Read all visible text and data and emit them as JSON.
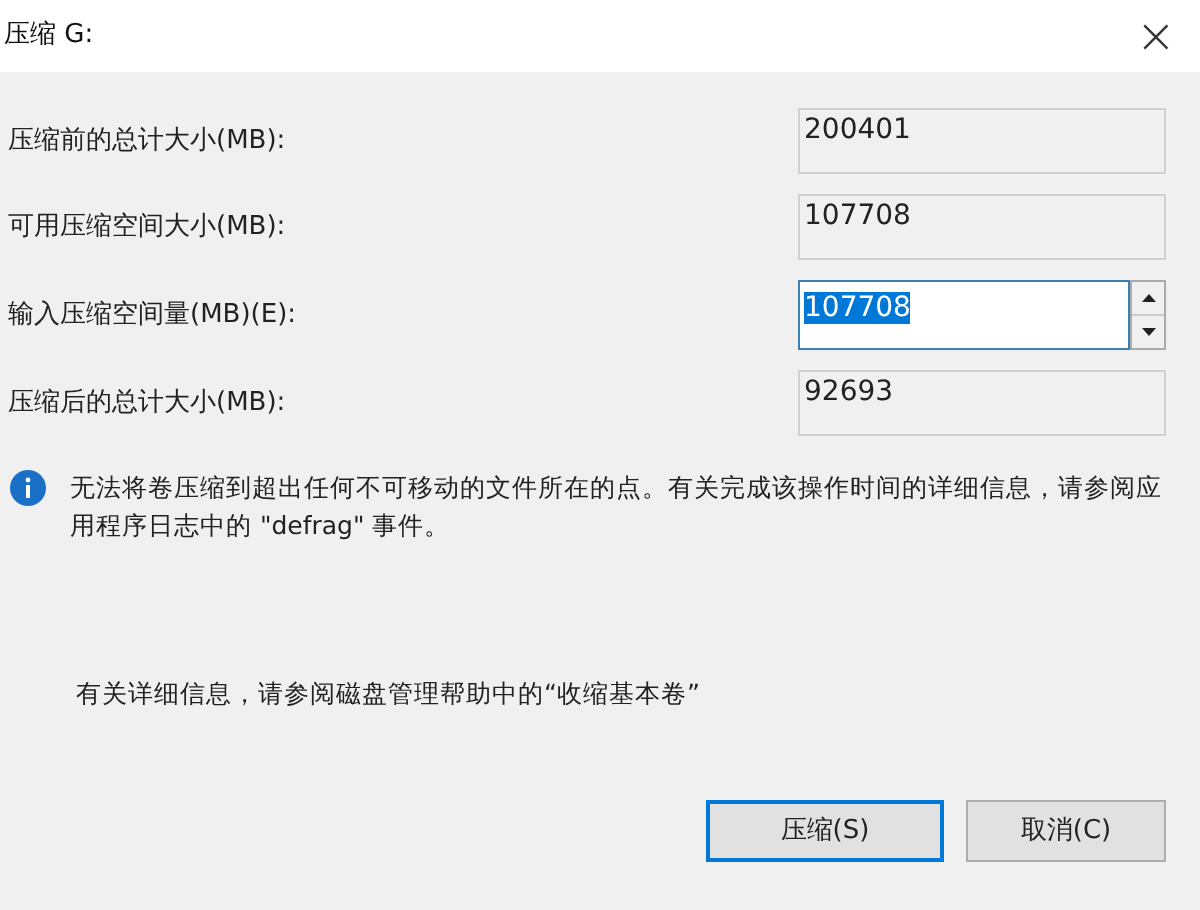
{
  "window": {
    "title": "压缩 G:",
    "close": "×"
  },
  "fields": [
    {
      "label": "压缩前的总计大小(MB):",
      "value": "200401",
      "kind": "readonly"
    },
    {
      "label": "可用压缩空间大小(MB):",
      "value": "107708",
      "kind": "readonly"
    },
    {
      "label": "输入压缩空间量(MB)(E):",
      "value": "107708",
      "kind": "spin",
      "selected": true
    },
    {
      "label": "压缩后的总计大小(MB):",
      "value": "92693",
      "kind": "readonly"
    }
  ],
  "info": "无法将卷压缩到超出任何不可移动的文件所在的点。有关完成该操作时间的详细信息，请参阅应用程序日志中的 \"defrag\" 事件。",
  "help": "有关详细信息，请参阅磁盘管理帮助中的“收缩基本卷”",
  "buttons": [
    {
      "label": "压缩(S)",
      "default": true
    },
    {
      "label": "取消(C)",
      "default": false
    }
  ]
}
